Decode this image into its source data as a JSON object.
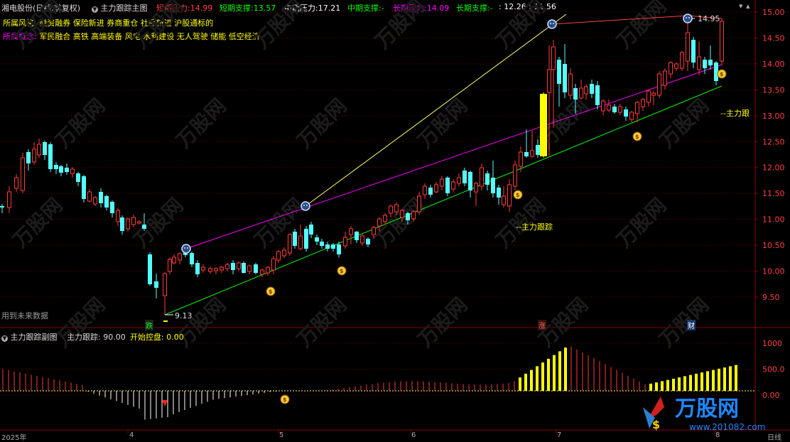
{
  "main_panel": {
    "title": "湘电股份(日线,前复权)",
    "indicator_name": "主力跟踪主图",
    "short_pressure_label": "短期压力:",
    "short_pressure_value": "14.99",
    "short_support_label": "短期支撑:",
    "short_support_value": "13.57",
    "mid_pressure_label": "中期压力:",
    "mid_pressure_value": "17.21",
    "mid_support_label": "中期支撑:",
    "mid_support_value": "-",
    "long_pressure_label": "长期压力:",
    "long_pressure_value": "14.09",
    "long_support_label": "长期支撑:",
    "long_support_value": "-",
    "extra_label": ":",
    "extra_values": "12.26 : 11.56",
    "style_label": "所属风格:",
    "style_value": "融资融券 保险新进 券商重仓 社保新进 沪股通标的",
    "concept_label": "所属概念:",
    "concept_value": "军民融合 高铁 高端装备 风电 水利建设 无人驾驶 储能 低空经济",
    "future_note": "用到未来数据",
    "low_price_label": "9.13",
    "high_price_label": "14.95",
    "trace_label_mid": "--主力跟踪",
    "trace_label_right": "--主力跟",
    "marker_down": "跌",
    "marker_up": "涨",
    "marker_fin": "财",
    "y_ticks": [
      "15.00",
      "14.50",
      "14.00",
      "13.50",
      "13.00",
      "12.50",
      "12.00",
      "11.50",
      "11.00",
      "10.50",
      "10.00",
      "9.50"
    ]
  },
  "sub_panel": {
    "indicator_name": "主力跟踪副图",
    "trace_label": "主力跟踪:",
    "trace_value": "90.00",
    "control_label": "开始控盘:",
    "control_value": "0.00",
    "y_ticks": [
      "1000",
      "500.0",
      "0.00"
    ]
  },
  "date_axis": {
    "labels": [
      "2025年",
      "4",
      "5",
      "6",
      "7",
      "8"
    ],
    "period": "日线"
  },
  "watermark": {
    "brand": "万股网",
    "url": "www.201082.com"
  },
  "colors": {
    "up": "#ff3a3a",
    "down": "#54ffff",
    "yellow": "#ffff00",
    "magenta": "#ff00ff",
    "green": "#00ff00",
    "grid": "#7a0000"
  }
}
